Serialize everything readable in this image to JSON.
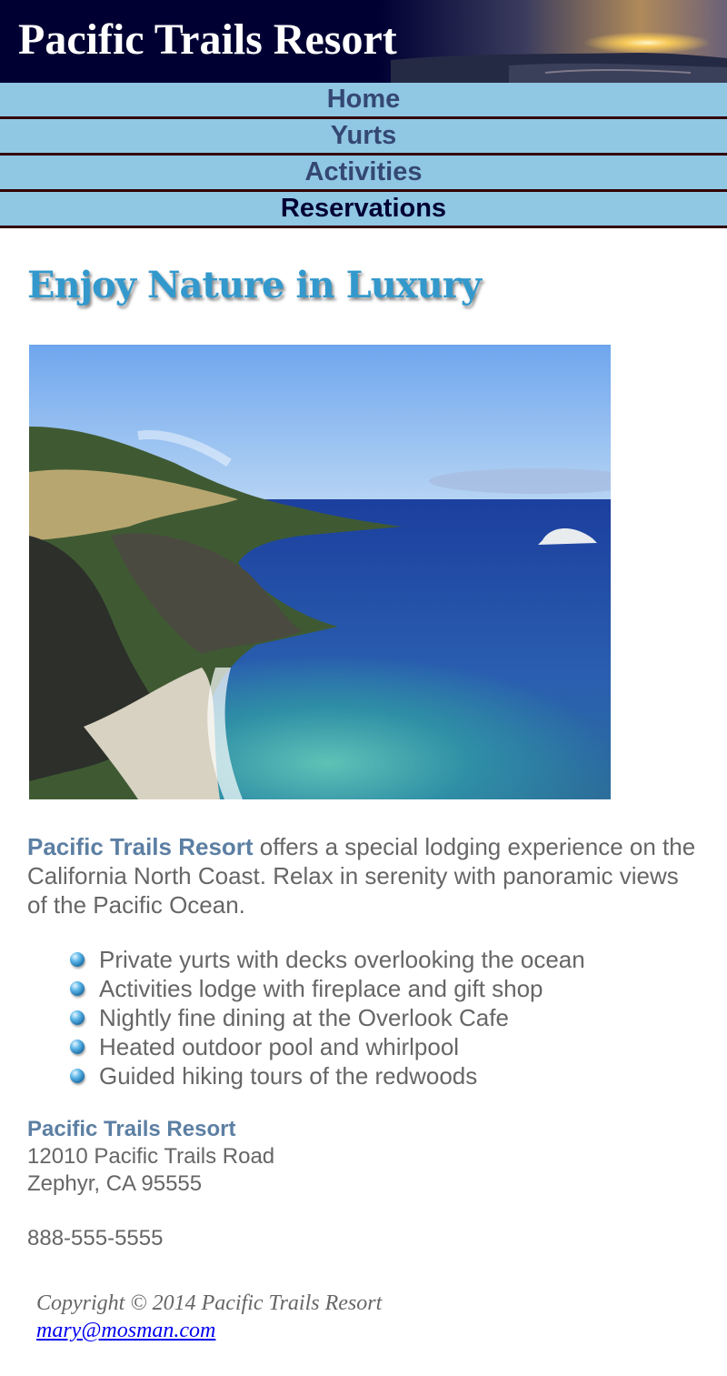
{
  "header": {
    "title": "Pacific Trails Resort"
  },
  "nav": {
    "items": [
      {
        "label": "Home"
      },
      {
        "label": "Yurts"
      },
      {
        "label": "Activities"
      },
      {
        "label": "Reservations"
      }
    ]
  },
  "main": {
    "headline": "Enjoy Nature in Luxury",
    "intro_brand": "Pacific Trails Resort",
    "intro_text": " offers a special lodging experience on the California North Coast. Relax in serenity with panoramic views of the Pacific Ocean.",
    "features": [
      "Private yurts with decks overlooking the ocean",
      "Activities lodge with fireplace and gift shop",
      "Nightly fine dining at the Overlook Cafe",
      "Heated outdoor pool and whirlpool",
      "Guided hiking tours of the redwoods"
    ],
    "address": {
      "name": "Pacific Trails Resort",
      "street": "12010 Pacific Trails Road",
      "city": "Zephyr, CA 95555",
      "phone": "888-555-5555"
    }
  },
  "footer": {
    "copyright": "Copyright © 2014 Pacific Trails Resort",
    "email": "mary@mosman.com"
  },
  "colors": {
    "header_bg": "#000033",
    "nav_bg": "#90c7e3",
    "nav_text": "#344873",
    "headline": "#3399cc",
    "brand_text": "#5c7fa3"
  }
}
